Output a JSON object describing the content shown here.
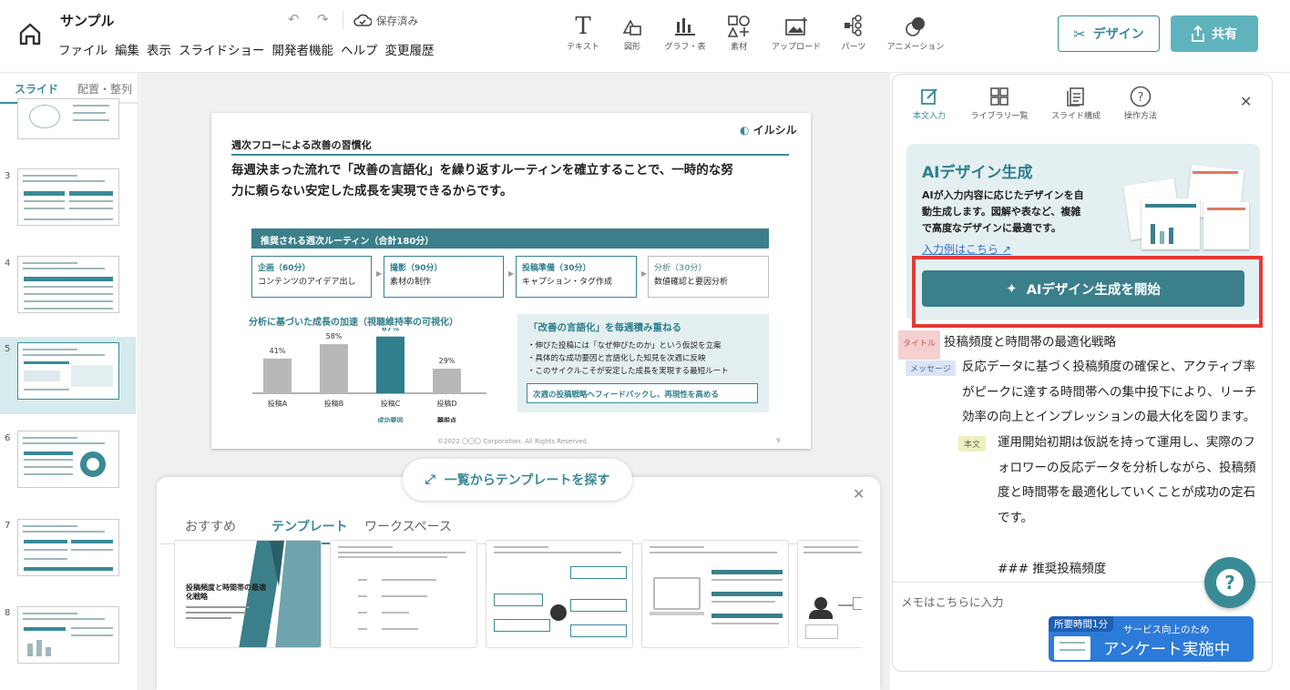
{
  "app": {
    "doc_title": "サンプル",
    "save_status": "保存済み",
    "menu": [
      "ファイル",
      "編集",
      "表示",
      "スライドショー",
      "開発者機能",
      "ヘルプ",
      "変更履歴"
    ]
  },
  "toolbar": {
    "text": "テキスト",
    "shape": "図形",
    "chart": "グラフ・表",
    "material": "素材",
    "upload": "アップロード",
    "parts": "パーツ",
    "animation": "アニメーション",
    "design_btn": "デザイン",
    "share_btn": "共有"
  },
  "left": {
    "tab_slides": "スライド",
    "tab_layout": "配置・整列",
    "slide_numbers": [
      "3",
      "4",
      "5",
      "6",
      "7",
      "8"
    ]
  },
  "slide": {
    "logo": "イルシル",
    "heading": "週次フローによる改善の習慣化",
    "lead_line1": "毎週決まった流れで「改善の言語化」を繰り返すルーティンを確立することで、一時的な努",
    "lead_line2": "力に頼らない安定した成長を実現できるからです。",
    "routine_title": "推奨される週次ルーティン（合計180分）",
    "steps": [
      {
        "title": "企画（60分）",
        "desc": "コンテンツのアイデア出し"
      },
      {
        "title": "撮影（90分）",
        "desc": "素材の制作"
      },
      {
        "title": "投稿準備（30分）",
        "desc": "キャプション・タグ作成"
      },
      {
        "title": "分析（30分）",
        "desc": "数値確認と要因分析"
      }
    ],
    "chart_title": "分析に基づいた成長の加速（視聴維持率の可視化）",
    "box_title": "「改善の言語化」を毎週積み重ねる",
    "bullets": [
      "・伸びた投稿には「なぜ伸びたのか」という仮説を立案",
      "・具体的な成功要因と言語化した知見を次週に反映",
      "・このサイクルこそが安定した成長を実現する最短ルート"
    ],
    "feedback": "次週の投稿戦略へフィードバックし、再現性を高める",
    "footer": "©2022 〇〇〇 Corporation. All Rights Reserved.",
    "page_no": "9"
  },
  "chart_data": {
    "type": "bar",
    "title": "分析に基づいた成長の加速（視聴維持率の可視化）",
    "categories": [
      "投稿A",
      "投稿B",
      "投稿C",
      "投稿D"
    ],
    "values": [
      41,
      58,
      67,
      29
    ],
    "value_labels": [
      "41%",
      "58%",
      "67%",
      "29%"
    ],
    "highlight_index": 2,
    "annotations": [
      {
        "category": "投稿C",
        "text": "成功要因"
      },
      {
        "category": "投稿D",
        "text": "離脱点"
      }
    ],
    "colors": {
      "default": "#b8b8b8",
      "highlight": "#2f7f8c"
    },
    "ylim": [
      0,
      80
    ],
    "grid": false
  },
  "templates": {
    "find_btn": "一覧からテンプレートを探す",
    "tabs": [
      "おすすめ",
      "テンプレート",
      "ワークスペース"
    ],
    "first_title": "投稿頻度と時間帯の最適化戦略"
  },
  "right": {
    "tabs": [
      "本文入力",
      "ライブラリ一覧",
      "スライド構成",
      "操作方法"
    ],
    "ai_title": "AIデザイン生成",
    "ai_desc_line1": "AIが入力内容に応じたデザインを自",
    "ai_desc_line2": "動生成します。図解や表など、複雑",
    "ai_desc_line3": "で高度なデザインに最適です。",
    "ai_link": "入力例はこちら",
    "ai_button": "AIデザイン生成を開始",
    "tag_title": "タイトル",
    "title_text": "投稿頻度と時間帯の最適化戦略",
    "tag_message": "メッセージ",
    "message_lines": [
      "反応データに基づく投稿頻度の確保と、アクティブ率",
      "がピークに達する時間帯への集中投下により、リーチ",
      "効率の向上とインプレッションの最大化を図ります。"
    ],
    "tag_body": "本文",
    "body_lines": [
      "運用開始初期は仮説を持って運用し、実際のフ",
      "ォロワーの反応データを分析しながら、投稿頻",
      "度と時間帯を最適化していくことが成功の定石",
      "です。"
    ],
    "body_heading": "### 推奨投稿頻度",
    "memo_placeholder": "メモはこちらに入力"
  },
  "survey": {
    "badge": "所要時間1分",
    "small": "サービス向上のため",
    "big": "アンケート実施中"
  },
  "colors": {
    "accent": "#3a8a96",
    "highlight_border": "#e53935"
  }
}
